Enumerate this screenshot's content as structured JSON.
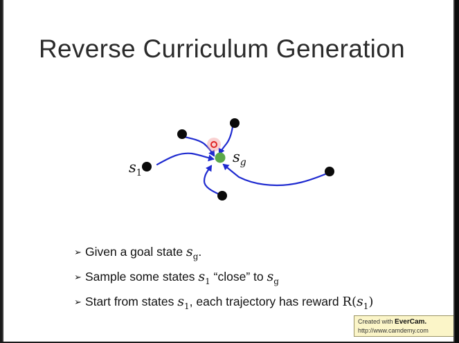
{
  "slide": {
    "title": "Reverse Curriculum Generation"
  },
  "diagram": {
    "start_label_base": "s",
    "start_label_sub": "1",
    "goal_label_base": "s",
    "goal_label_sub": "g",
    "colors": {
      "arrow": "#1f2bd0",
      "goal": "#5aa84a",
      "state": "#0a0a0a",
      "cursor": "#e02424"
    }
  },
  "bullets": [
    {
      "marker": "➢",
      "text_1": "Given a goal state ",
      "math_base": "s",
      "math_sub": "g",
      "text_2": "."
    },
    {
      "marker": "➢",
      "text_1": "Sample some states ",
      "math1_base": "s",
      "math1_sub": "1",
      "text_2": " “close” to ",
      "math2_base": "s",
      "math2_sub": "g"
    },
    {
      "marker": "➢",
      "text_1": "Start from states ",
      "math1_base": "s",
      "math1_sub": "1",
      "text_2": ", each trajectory has reward ",
      "reward_prefix": "R(",
      "reward_base": "s",
      "reward_sub": "1",
      "reward_suffix": ")"
    }
  ],
  "watermark": {
    "line1_prefix": "Created with ",
    "brand": "EverCam",
    "brand_suffix": ".",
    "line2": "http://www.camdemy.com"
  }
}
